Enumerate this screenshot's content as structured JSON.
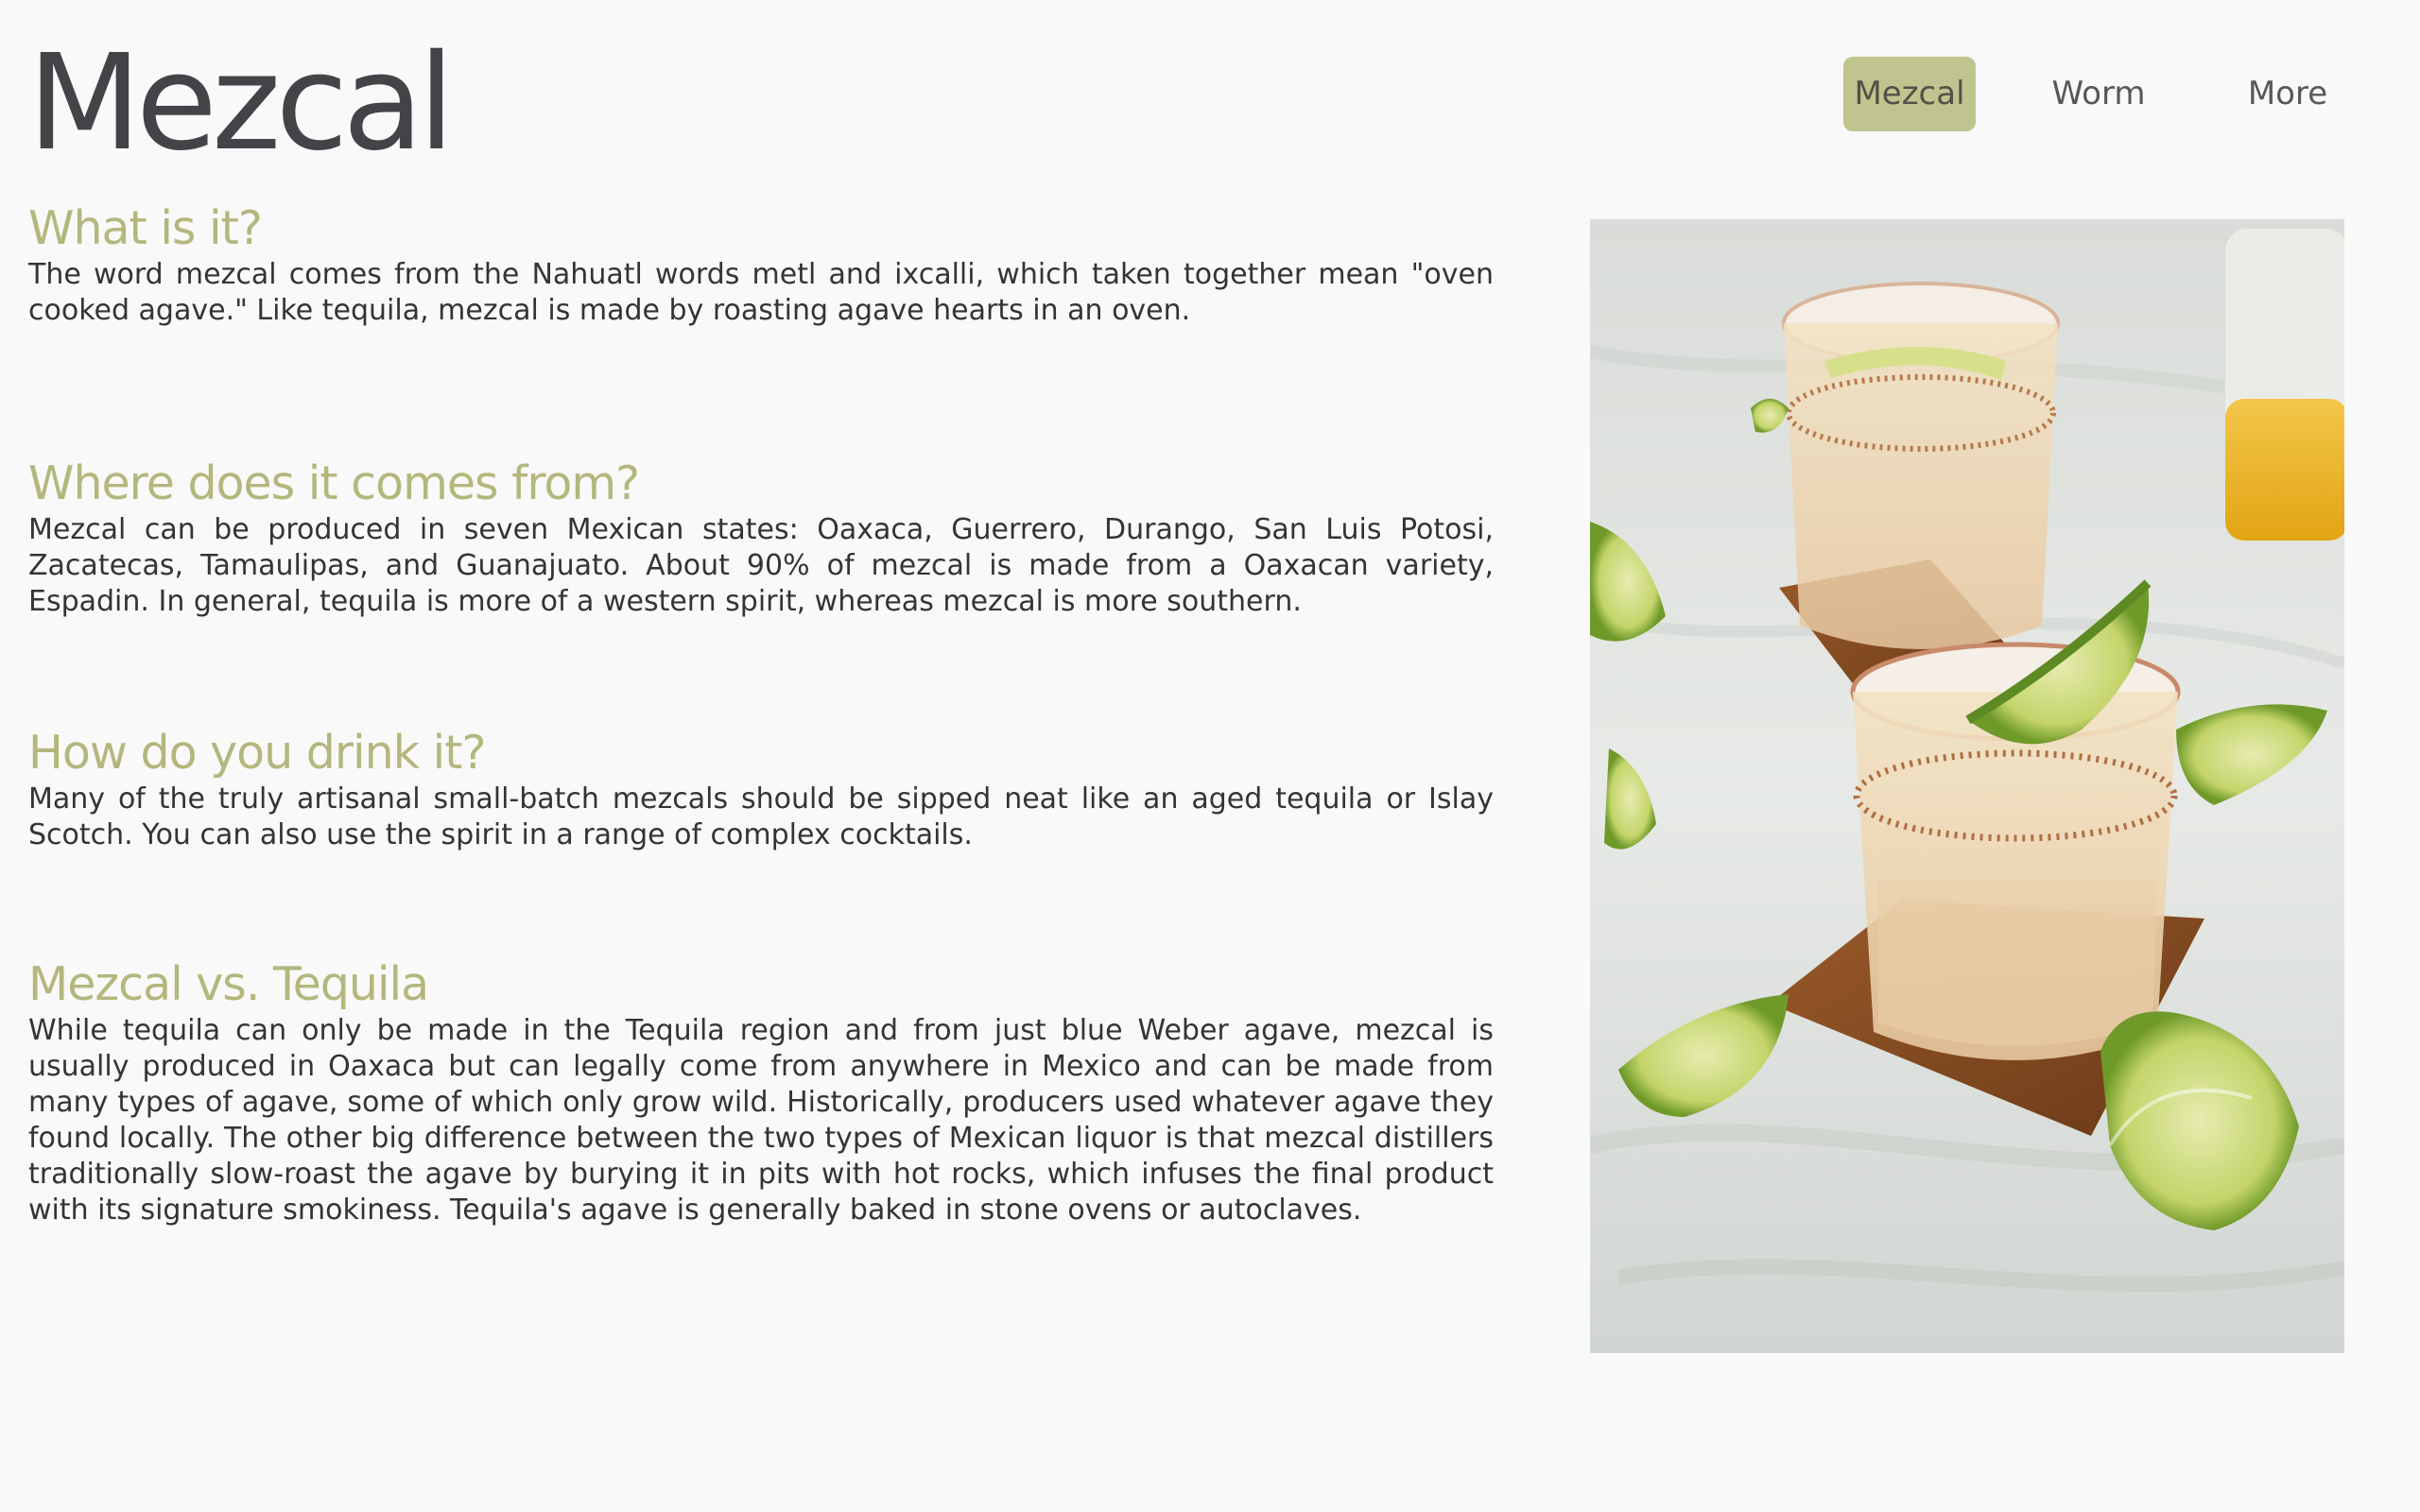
{
  "header": {
    "title": "Mezcal"
  },
  "nav": {
    "items": [
      {
        "label": "Mezcal",
        "active": true
      },
      {
        "label": "Worm",
        "active": false
      },
      {
        "label": "More",
        "active": false
      }
    ]
  },
  "sections": [
    {
      "heading": "What is it?",
      "body": "The word mezcal comes from the Nahuatl words metl and ixcalli, which taken together mean \"oven cooked agave.\" Like tequila, mezcal is made by roasting agave hearts in an oven."
    },
    {
      "heading": "Where does it comes from?",
      "body": "Mezcal can be produced in seven Mexican states: Oaxaca, Guerrero, Durango, San Luis Potosi, Zacatecas, Tamaulipas, and Guanajuato. About 90% of mezcal is made from a Oaxacan variety, Espadin. In general, tequila is more of a western spirit, whereas mezcal is more southern."
    },
    {
      "heading": "How do you drink it?",
      "body": "Many of the truly artisanal small-batch mezcals should be sipped neat like an aged tequila or Islay Scotch. You can also use the spirit in a range of complex cocktails."
    },
    {
      "heading": "Mezcal vs. Tequila",
      "body": "While tequila can only be made in the Tequila region and from just blue Weber agave, mezcal is usually produced in Oaxaca but can legally come from anywhere in Mexico and can be made from many types of agave, some of which only grow wild. Historically, producers used whatever agave they found locally. The other big difference between the two types of Mexican liquor is that mezcal distillers traditionally slow-roast the agave by burying it in pits with hot rocks, which infuses the final product with its signature smokiness. Tequila's agave is generally baked in stone ovens or autoclaves."
    }
  ],
  "colors": {
    "accent": "#b4b77d",
    "nav_active_bg": "#c0c48f",
    "page_bg": "#f9f9f9",
    "title": "#434448"
  }
}
